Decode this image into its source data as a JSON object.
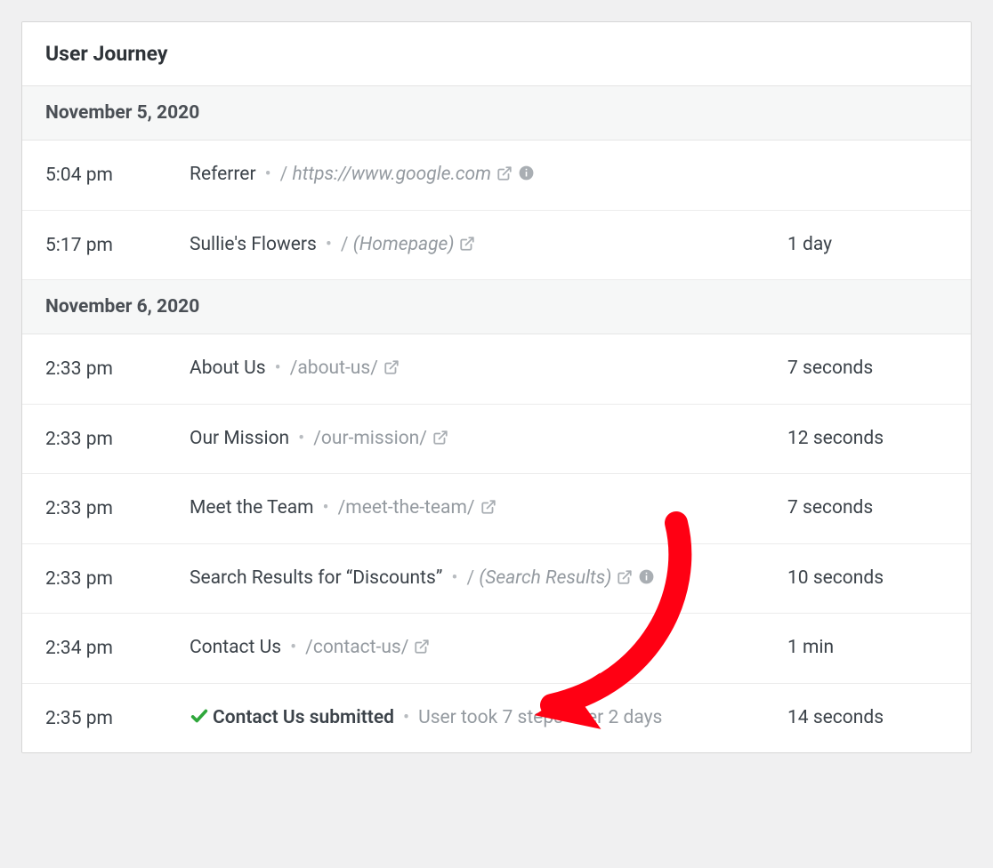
{
  "panel": {
    "title": "User Journey"
  },
  "groups": [
    {
      "date": "November 5, 2020",
      "rows": [
        {
          "time": "5:04 pm",
          "title": "Referrer",
          "path_prefix": "/ ",
          "path": "https://www.google.com",
          "italic": true,
          "ext": true,
          "info": true,
          "duration": ""
        },
        {
          "time": "5:17 pm",
          "title": "Sullie's Flowers",
          "path_prefix": "/ ",
          "path": "(Homepage)",
          "italic": true,
          "ext": true,
          "info": false,
          "duration": "1 day"
        }
      ]
    },
    {
      "date": "November 6, 2020",
      "rows": [
        {
          "time": "2:33 pm",
          "title": "About Us",
          "path_prefix": "",
          "path": "/about-us/",
          "italic": false,
          "ext": true,
          "info": false,
          "duration": "7 seconds"
        },
        {
          "time": "2:33 pm",
          "title": "Our Mission",
          "path_prefix": "",
          "path": "/our-mission/",
          "italic": false,
          "ext": true,
          "info": false,
          "duration": "12 seconds"
        },
        {
          "time": "2:33 pm",
          "title": "Meet the Team",
          "path_prefix": "",
          "path": "/meet-the-team/",
          "italic": false,
          "ext": true,
          "info": false,
          "duration": "7 seconds"
        },
        {
          "time": "2:33 pm",
          "title": "Search Results for “Discounts”",
          "path_prefix": "/ ",
          "path": "(Search Results)",
          "italic": true,
          "ext": true,
          "info": true,
          "duration": "10 seconds"
        },
        {
          "time": "2:34 pm",
          "title": "Contact Us",
          "path_prefix": "",
          "path": "/contact-us/",
          "italic": false,
          "ext": true,
          "info": false,
          "duration": "1 min"
        },
        {
          "time": "2:35 pm",
          "check": true,
          "title_bold": "Contact Us submitted",
          "summary": "User took 7 steps over 2 days",
          "duration": "14 seconds"
        }
      ]
    }
  ]
}
